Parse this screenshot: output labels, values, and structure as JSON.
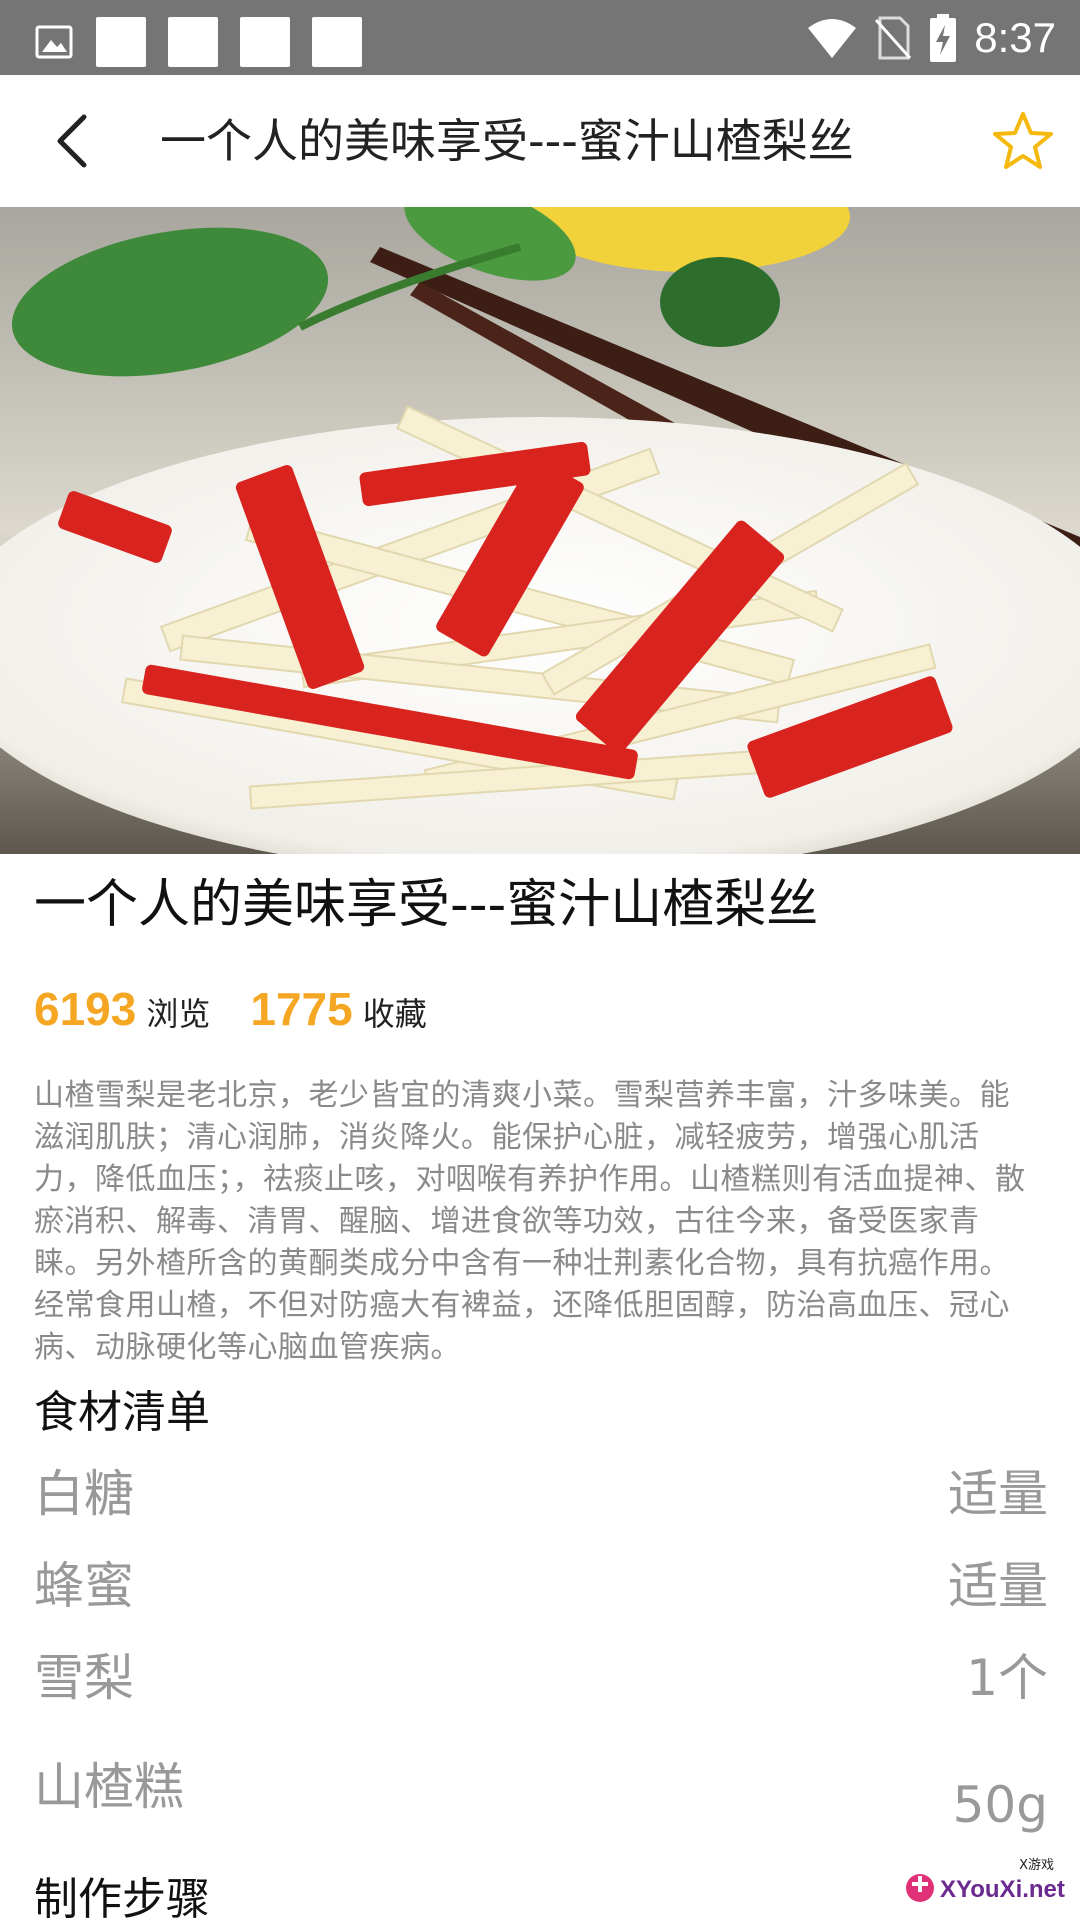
{
  "status_bar": {
    "time": "8:37"
  },
  "app_bar": {
    "title": "一个人的美味享受---蜜汁山楂梨丝",
    "back_icon": "chevron-left-icon",
    "favorite_icon": "star-outline-icon"
  },
  "recipe": {
    "title": "一个人的美味享受---蜜汁山楂梨丝",
    "views": "6193",
    "views_label": "浏览",
    "favorites": "1775",
    "favorites_label": "收藏",
    "description": "山楂雪梨是老北京，老少皆宜的清爽小菜。雪梨营养丰富，汁多味美。能滋润肌肤；清心润肺，消炎降火。能保护心脏，减轻疲劳，增强心肌活力，降低血压；，祛痰止咳，对咽喉有养护作用。山楂糕则有活血提神、散瘀消积、解毒、清胃、醒脑、增进食欲等功效，古往今来，备受医家青睐。另外楂所含的黄酮类成分中含有一种壮荆素化合物，具有抗癌作用。经常食用山楂，不但对防癌大有裨益，还降低胆固醇，防治高血压、冠心病、动脉硬化等心脑血管疾病。"
  },
  "ingredients": {
    "heading": "食材清单",
    "items": [
      {
        "name": "白糖",
        "amount": "适量"
      },
      {
        "name": "蜂蜜",
        "amount": "适量"
      },
      {
        "name": "雪梨",
        "amount": "1个"
      },
      {
        "name": "山楂糕",
        "amount": "50g"
      }
    ]
  },
  "steps": {
    "heading": "制作步骤"
  },
  "watermark": {
    "text": "XYouXi.net",
    "small": "X游戏"
  },
  "colors": {
    "accent": "#f5a623",
    "status_bar": "#757575",
    "muted_text": "#999999"
  }
}
